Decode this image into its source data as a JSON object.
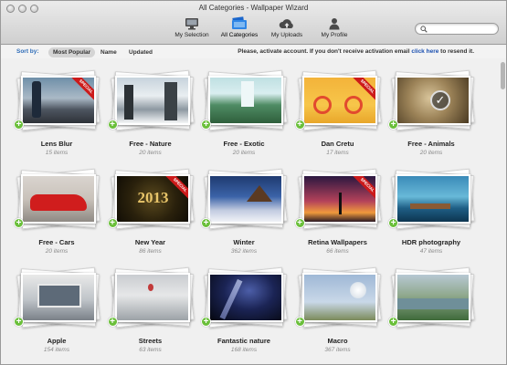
{
  "window": {
    "title": "All Categories - Wallpaper Wizard"
  },
  "toolbar": {
    "tabs": [
      {
        "label": "My Selection",
        "icon": "monitor-icon"
      },
      {
        "label": "All Categories",
        "icon": "folder-icon",
        "active": true
      },
      {
        "label": "My Uploads",
        "icon": "cloud-upload-icon"
      },
      {
        "label": "My Profile",
        "icon": "person-icon"
      }
    ],
    "search": {
      "placeholder": ""
    }
  },
  "sortbar": {
    "label": "Sort by:",
    "options": [
      "Most Popular",
      "Name",
      "Updated"
    ],
    "selected": "Most Popular",
    "notice": "Please, activate account. If you don't receive activation email",
    "notice_link": "click here",
    "notice_suffix": "to resend it."
  },
  "categories": [
    {
      "name": "Lens Blur",
      "count": "15 items",
      "special": true
    },
    {
      "name": "Free - Nature",
      "count": "20 items",
      "special": false
    },
    {
      "name": "Free - Exotic",
      "count": "20 items",
      "special": false
    },
    {
      "name": "Dan Cretu",
      "count": "17 items",
      "special": true
    },
    {
      "name": "Free - Animals",
      "count": "20 items",
      "special": false,
      "selected": true
    },
    {
      "name": "Free - Cars",
      "count": "20 items",
      "special": false
    },
    {
      "name": "New Year",
      "count": "86 items",
      "special": true
    },
    {
      "name": "Winter",
      "count": "362 items",
      "special": false
    },
    {
      "name": "Retina Wallpapers",
      "count": "66 items",
      "special": true
    },
    {
      "name": "HDR photography",
      "count": "47 items",
      "special": false
    },
    {
      "name": "Apple",
      "count": "154 items",
      "special": false
    },
    {
      "name": "Streets",
      "count": "63 items",
      "special": false
    },
    {
      "name": "Fantastic nature",
      "count": "168 items",
      "special": false
    },
    {
      "name": "Macro",
      "count": "367 items",
      "special": false
    },
    {
      "name": "",
      "count": "",
      "special": false
    }
  ],
  "ribbon_text": "SPECIAL",
  "colors": {
    "accent": "#2f6db8",
    "plus": "#6abf3a",
    "ribbon": "#cc1a1a"
  }
}
